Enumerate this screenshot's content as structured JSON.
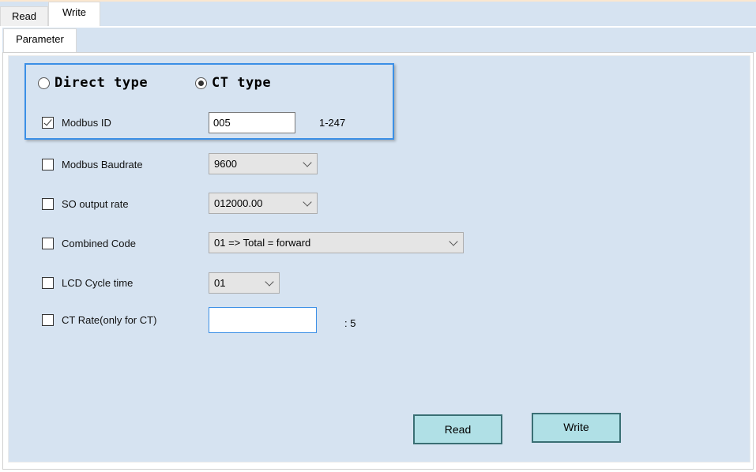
{
  "outer_tabs": [
    {
      "label": "Read",
      "active": false
    },
    {
      "label": "Write",
      "active": true
    }
  ],
  "inner_tabs": [
    {
      "label": "Parameter",
      "active": true
    }
  ],
  "type_select": {
    "options": [
      {
        "label": "Direct type",
        "checked": false
      },
      {
        "label": "CT type",
        "checked": true
      }
    ]
  },
  "fields": {
    "modbus_id": {
      "label": "Modbus ID",
      "checked": true,
      "value": "005",
      "hint": "1-247"
    },
    "modbus_baudrate": {
      "label": "Modbus Baudrate",
      "checked": false,
      "value": "9600"
    },
    "so_output_rate": {
      "label": "SO output rate",
      "checked": false,
      "value": "012000.00"
    },
    "combined_code": {
      "label": "Combined Code",
      "checked": false,
      "value": "01 => Total = forward"
    },
    "lcd_cycle_time": {
      "label": "LCD Cycle time",
      "checked": false,
      "value": "01"
    },
    "ct_rate": {
      "label": "CT Rate(only for CT)",
      "checked": false,
      "value": "",
      "hint": ": 5"
    }
  },
  "buttons": {
    "read": "Read",
    "write": "Write"
  },
  "colors": {
    "panel_bg": "#d6e3f1",
    "group_border": "#3b8fe6",
    "button_bg": "#b0e0e6",
    "button_border": "#3a6f74"
  }
}
